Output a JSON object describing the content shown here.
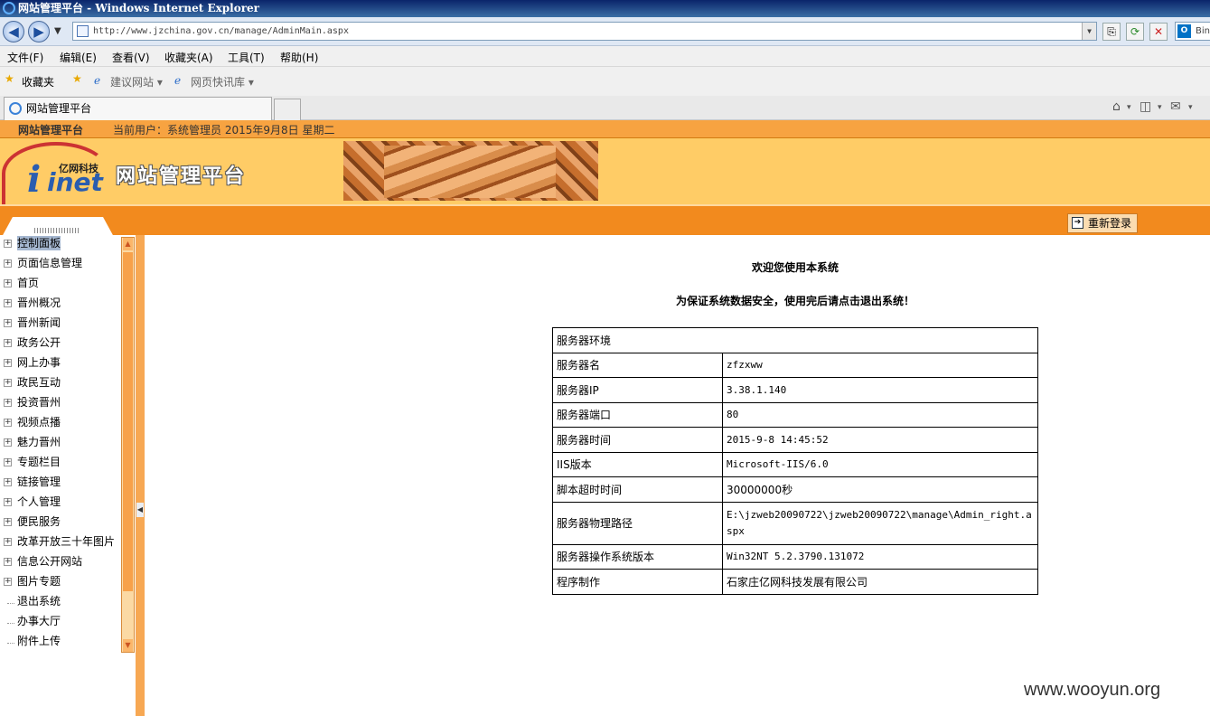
{
  "window": {
    "title": "网站管理平台 - Windows Internet Explorer"
  },
  "address": {
    "url": "http://www.jzchina.gov.cn/manage/AdminMain.aspx",
    "search_label": "Bin"
  },
  "menu": [
    "文件(F)",
    "编辑(E)",
    "查看(V)",
    "收藏夹(A)",
    "工具(T)",
    "帮助(H)"
  ],
  "favorites": {
    "label": "收藏夹",
    "suggested": "建议网站 ▾",
    "web_slice": "网页快讯库 ▾"
  },
  "tab": {
    "title": "网站管理平台"
  },
  "status": {
    "site": "网站管理平台",
    "user_info": "当前用户：系统管理员  2015年9月8日  星期二"
  },
  "banner": {
    "logo_text": "亿网科技",
    "logo_mark": "inet",
    "title": "网站管理平台"
  },
  "actions": {
    "relogin": "重新登录"
  },
  "sidebar": {
    "items": [
      {
        "label": "控制面板",
        "expandable": true
      },
      {
        "label": "页面信息管理",
        "expandable": true
      },
      {
        "label": "首页",
        "expandable": true
      },
      {
        "label": "晋州概况",
        "expandable": true
      },
      {
        "label": "晋州新闻",
        "expandable": true
      },
      {
        "label": "政务公开",
        "expandable": true
      },
      {
        "label": "网上办事",
        "expandable": true
      },
      {
        "label": "政民互动",
        "expandable": true
      },
      {
        "label": "投资晋州",
        "expandable": true
      },
      {
        "label": "视频点播",
        "expandable": true
      },
      {
        "label": "魅力晋州",
        "expandable": true
      },
      {
        "label": "专题栏目",
        "expandable": true
      },
      {
        "label": "链接管理",
        "expandable": true
      },
      {
        "label": "个人管理",
        "expandable": true
      },
      {
        "label": "便民服务",
        "expandable": true
      },
      {
        "label": "改革开放三十年图片",
        "expandable": true
      },
      {
        "label": "信息公开网站",
        "expandable": true
      },
      {
        "label": "图片专题",
        "expandable": true
      },
      {
        "label": "退出系统",
        "expandable": false
      },
      {
        "label": "办事大厅",
        "expandable": false
      },
      {
        "label": "附件上传",
        "expandable": false
      }
    ]
  },
  "main": {
    "welcome": "欢迎您使用本系统",
    "notice": "为保证系统数据安全，使用完后请点击退出系统！",
    "table_header": "服务器环境",
    "rows": [
      {
        "key": "服务器名",
        "value": "zfzxww"
      },
      {
        "key": "服务器IP",
        "value": "3.38.1.140"
      },
      {
        "key": "服务器端口",
        "value": "80"
      },
      {
        "key": "服务器时间",
        "value": "2015-9-8 14:45:52"
      },
      {
        "key": "IIS版本",
        "value": "Microsoft-IIS/6.0"
      },
      {
        "key": "脚本超时时间",
        "value": "30000000秒"
      },
      {
        "key": "服务器物理路径",
        "value": "E:\\jzweb20090722\\jzweb20090722\\manage\\Admin_right.aspx"
      },
      {
        "key": "服务器操作系统版本",
        "value": "Win32NT 5.2.3790.131072"
      },
      {
        "key": "程序制作",
        "value": "石家庄亿网科技发展有限公司"
      }
    ]
  },
  "watermark": "www.wooyun.org"
}
